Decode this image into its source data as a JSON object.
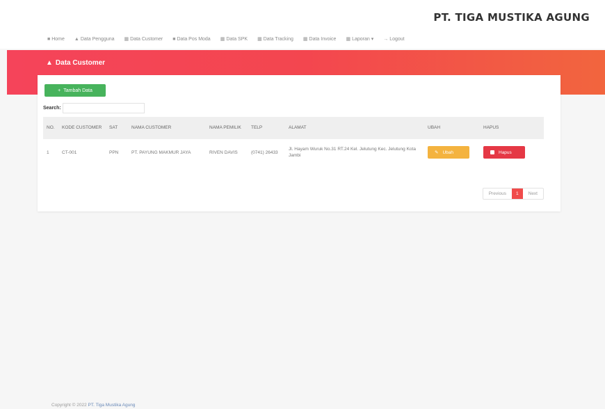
{
  "brand": "PT. TIGA MUSTIKA AGUNG",
  "nav": [
    {
      "icon": "home-icon",
      "glyph": "■",
      "label": "Home"
    },
    {
      "icon": "user-icon",
      "glyph": "▲",
      "label": "Data Pengguna"
    },
    {
      "icon": "table-icon",
      "glyph": "▦",
      "label": "Data Customer"
    },
    {
      "icon": "truck-icon",
      "glyph": "■",
      "label": "Data Pos Moda"
    },
    {
      "icon": "table-icon",
      "glyph": "▦",
      "label": "Data SPK"
    },
    {
      "icon": "table-icon",
      "glyph": "▦",
      "label": "Data Tracking"
    },
    {
      "icon": "table-icon",
      "glyph": "▦",
      "label": "Data Invoice"
    },
    {
      "icon": "report-icon",
      "glyph": "▦",
      "label": "Laporan ▾"
    },
    {
      "icon": "logout-icon",
      "glyph": "→",
      "label": "Logout"
    }
  ],
  "page_title": "Data Customer",
  "add_button": "Tambah Data",
  "search_label": "Search:",
  "search_value": "",
  "table": {
    "headers": [
      "NO.",
      "KODE CUSTOMER",
      "SAT",
      "NAMA CUSTOMER",
      "NAMA PEMILIK",
      "TELP",
      "ALAMAT",
      "UBAH",
      "HAPUS"
    ],
    "rows": [
      {
        "no": "1",
        "kode": "CT-001",
        "sat": "PPN",
        "nama": "PT. PAYUNG MAKMUR JAYA",
        "pemilik": "RIVEN DAVIS",
        "telp": "(0741) 26433",
        "alamat": "Jl. Hayam Wuruk No.31 RT.24 Kel. Jelutung Kec. Jelutung Kota Jambi",
        "ubah": "Ubah",
        "hapus": "Hapus"
      }
    ]
  },
  "pagination": {
    "previous": "Previous",
    "current": "1",
    "next": "Next"
  },
  "footer": {
    "prefix": "Copyright © 2022",
    "link": "PT. Tiga Mustika Agung"
  },
  "colors": {
    "accent_red": "#f3464f",
    "accent_orange": "#f2653e",
    "button_green": "#47b35c",
    "button_yellow": "#f4b33f",
    "button_red": "#e53845"
  }
}
